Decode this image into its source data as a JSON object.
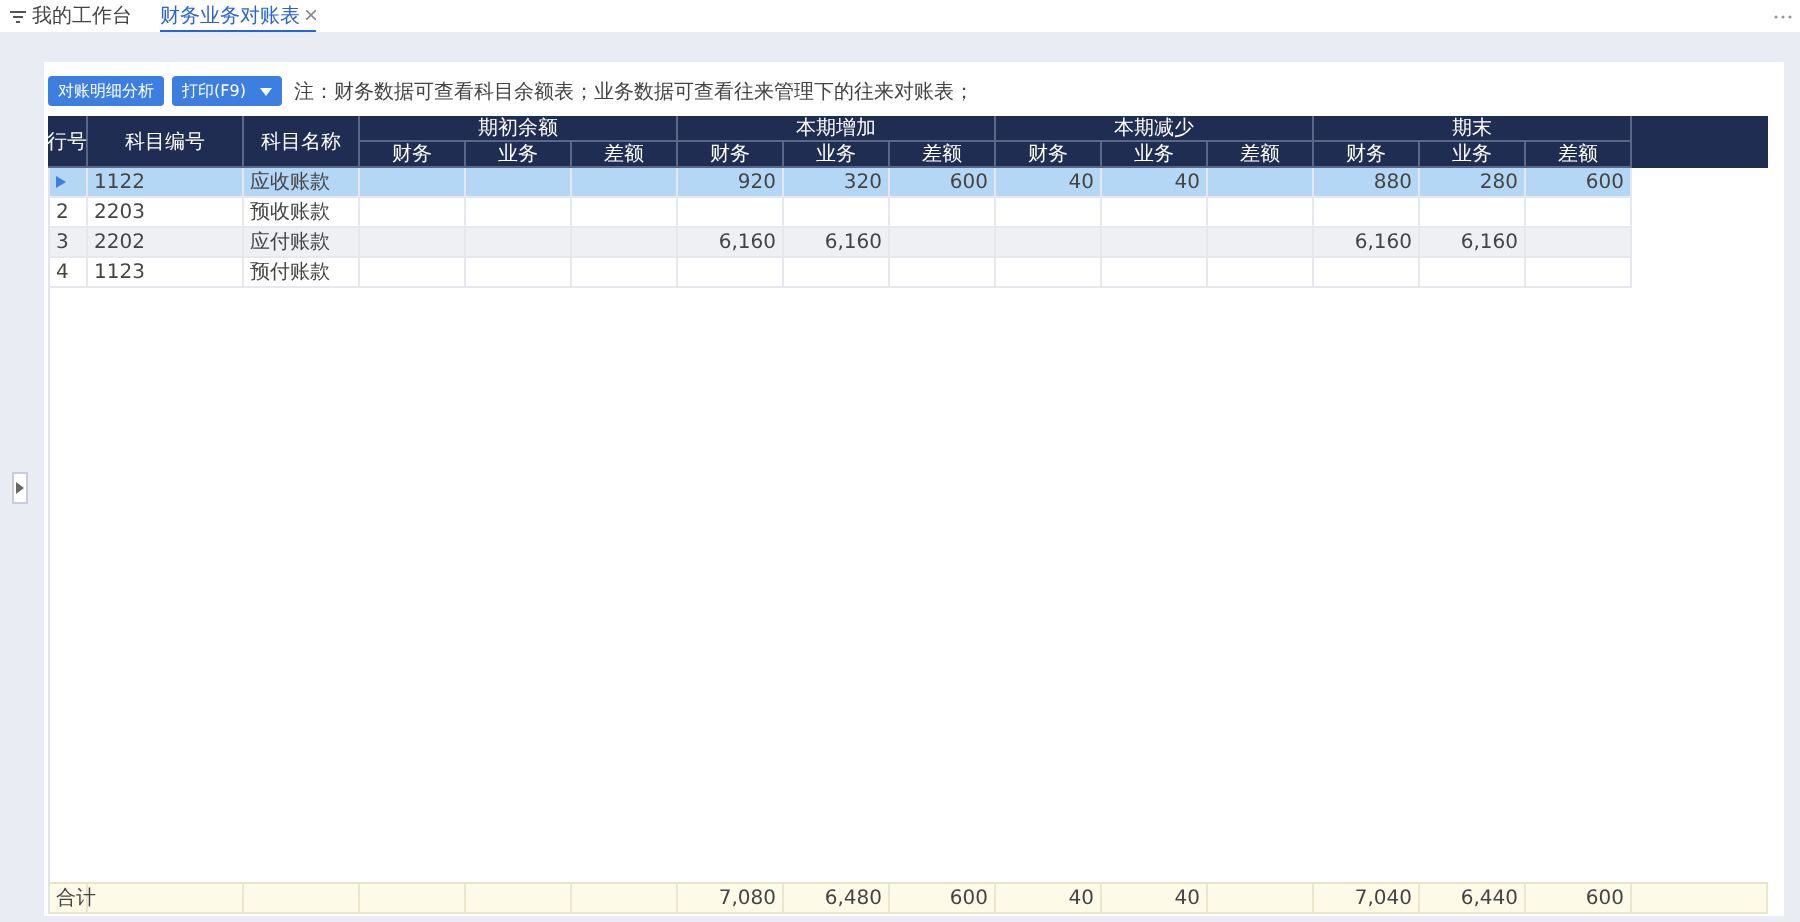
{
  "tabs": [
    {
      "label": "我的工作台",
      "selected": false,
      "closable": false
    },
    {
      "label": "财务业务对账表",
      "selected": true,
      "closable": true
    }
  ],
  "toolbar": {
    "analysis_button": "对账明细分析",
    "print_button": "打印(F9)",
    "note": "注：财务数据可查看科目余额表；业务数据可查看往来管理下的往来对账表；"
  },
  "table": {
    "columns": [
      "行号",
      "科目编号",
      "科目名称"
    ],
    "groups": [
      {
        "label": "期初余额",
        "columns": [
          "财务",
          "业务",
          "差额"
        ]
      },
      {
        "label": "本期增加",
        "columns": [
          "财务",
          "业务",
          "差额"
        ]
      },
      {
        "label": "本期减少",
        "columns": [
          "财务",
          "业务",
          "差额"
        ]
      },
      {
        "label": "期末",
        "columns": [
          "财务",
          "业务",
          "差额"
        ]
      }
    ],
    "rows": [
      {
        "selected": true,
        "code": "1122",
        "name": "应收账款",
        "increase": {
          "finance": "920",
          "business": "320",
          "difference": "600"
        },
        "decrease": {
          "finance": "40",
          "business": "40"
        },
        "closing": {
          "finance": "880",
          "business": "280",
          "difference": "600"
        }
      },
      {
        "selected": false,
        "number": "2",
        "code": "2203",
        "name": "预收账款"
      },
      {
        "selected": false,
        "number": "3",
        "code": "2202",
        "name": "应付账款",
        "increase": {
          "finance": "6,160",
          "business": "6,160"
        },
        "closing": {
          "finance": "6,160",
          "business": "6,160"
        }
      },
      {
        "selected": false,
        "number": "4",
        "code": "1123",
        "name": "预付账款"
      }
    ],
    "total": {
      "label": "合计",
      "increase": {
        "finance": "7,080",
        "business": "6,480",
        "difference": "600"
      },
      "decrease": {
        "finance": "40",
        "business": "40"
      },
      "closing": {
        "finance": "7,040",
        "business": "6,440",
        "difference": "600"
      }
    }
  }
}
